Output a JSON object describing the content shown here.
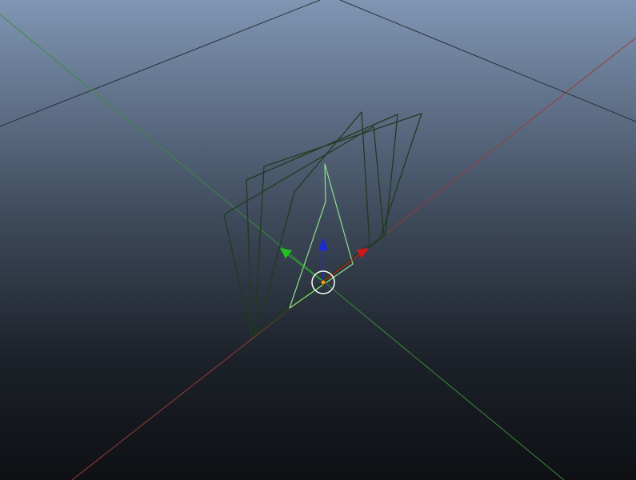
{
  "viewport": {
    "projection": "perspective",
    "view": "3D viewport",
    "background": {
      "top": "#7f96b3",
      "bottom": "#0e1014"
    }
  },
  "grid": {
    "color": "#2a2f36"
  },
  "axes": {
    "x": {
      "color": "#b3323a"
    },
    "y": {
      "color": "#3fae3f"
    },
    "z": {
      "color": "#1a2bd6"
    }
  },
  "object": {
    "type": "wireframe-mesh",
    "shape": "fanned-planes",
    "plane_count": 4,
    "wire_color": "#1f3a1f",
    "selected_color": "#8fe08f"
  },
  "gizmo": {
    "mode": "translate",
    "handles": [
      "x-arrow",
      "y-arrow",
      "z-arrow",
      "center-ring"
    ],
    "ring_color": "#ffffff",
    "pivot_color": "#f0a020"
  }
}
